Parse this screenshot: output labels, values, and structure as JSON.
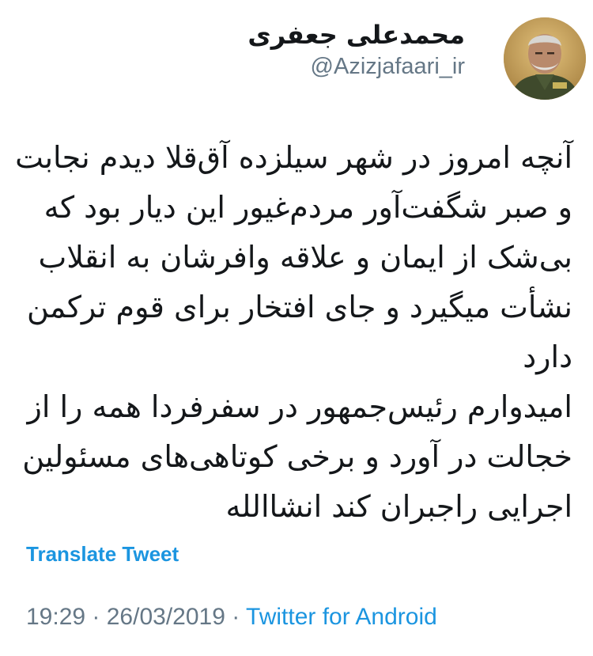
{
  "author": {
    "display_name": "محمدعلی جعفری",
    "handle": "@Azizjafaari_ir"
  },
  "tweet": {
    "lines": [
      "آنچه امروز در شهر سیلزده آق‌قلا دیدم نجابت",
      "و صبر شگفت‌آور مردم‌غیور این دیار بود که",
      "بی‌شک از ایمان و علاقه وافرشان به انقلاب",
      "نشأت میگیرد و جای افتخار برای قوم ترکمن",
      "دارد",
      "امیدوارم رئیس‌جمهور در سفرفردا همه را از",
      "خجالت در آورد و برخی کوتاهی‌های مسئولین",
      "اجرایی راجبران کند انشاالله"
    ]
  },
  "translate_label": "Translate Tweet",
  "meta": {
    "time": "19:29",
    "separator": " · ",
    "date": "26/03/2019",
    "source": "Twitter for Android"
  },
  "colors": {
    "link": "#1b95e0",
    "secondary_text": "#657786",
    "primary_text": "#14171a"
  },
  "icons": {
    "menu": "chevron-down-icon"
  }
}
